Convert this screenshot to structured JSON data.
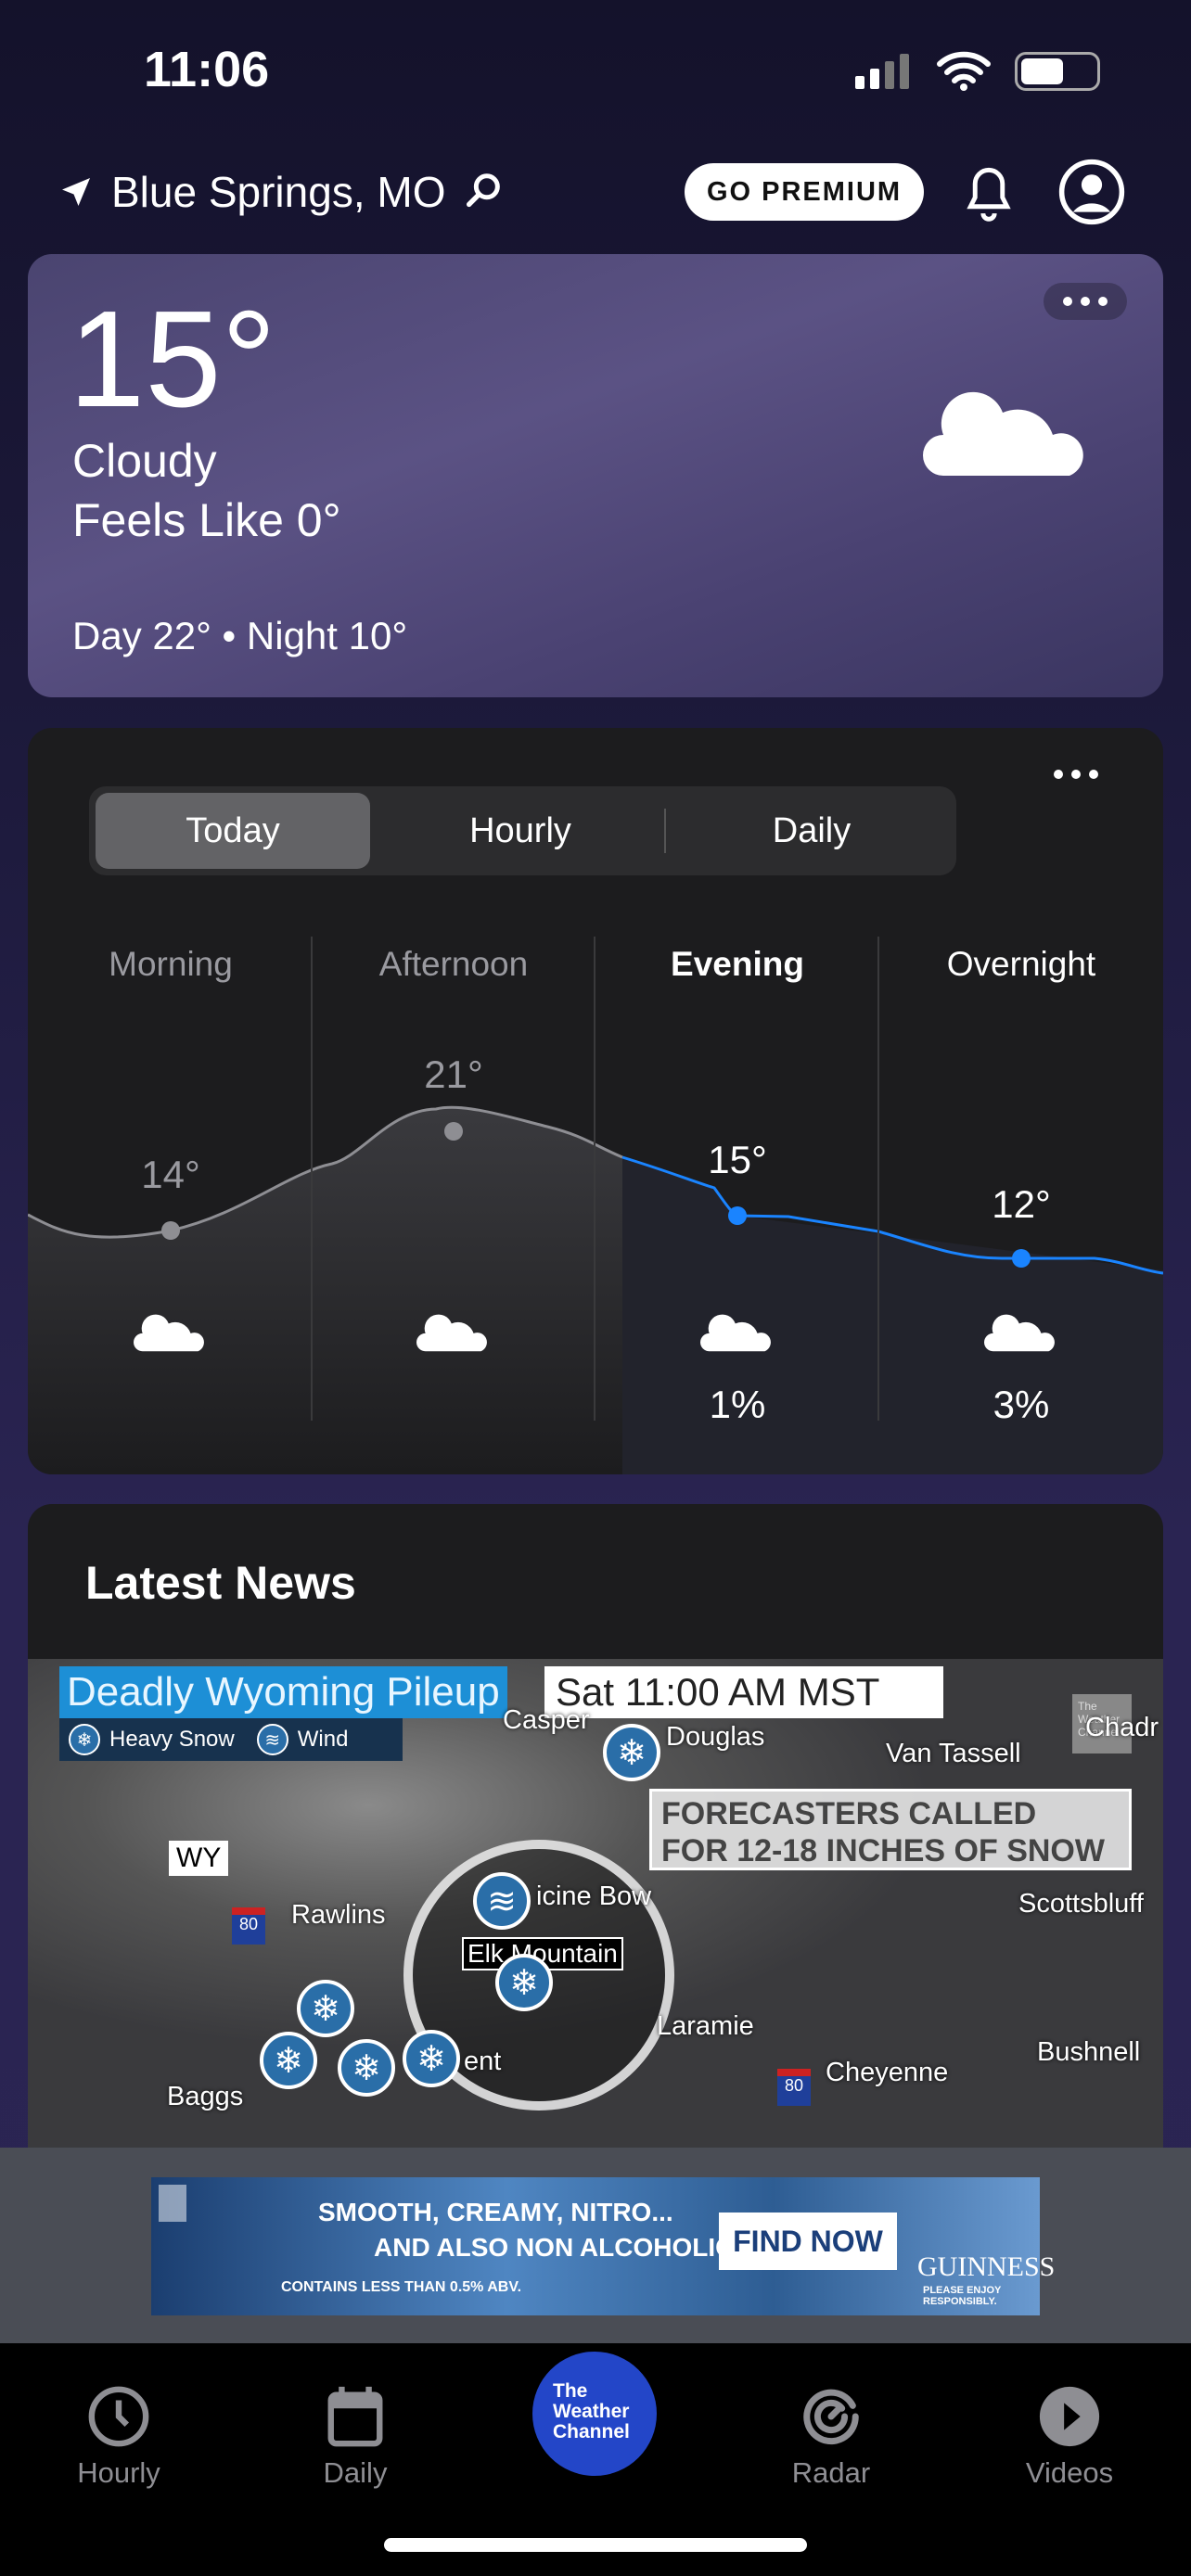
{
  "status": {
    "time": "11:06"
  },
  "header": {
    "location": "Blue Springs, MO",
    "premium_label": "GO PREMIUM"
  },
  "current": {
    "temp": "15°",
    "condition": "Cloudy",
    "feels_like": "Feels Like 0°",
    "day_night": "Day 22° • Night 10°",
    "icon": "cloud-icon"
  },
  "forecast": {
    "tabs": [
      {
        "label": "Today",
        "selected": true
      },
      {
        "label": "Hourly"
      },
      {
        "label": "Daily"
      }
    ],
    "periods": [
      {
        "label": "Morning",
        "temp": "14°",
        "precip": ""
      },
      {
        "label": "Afternoon",
        "temp": "21°",
        "precip": ""
      },
      {
        "label": "Evening",
        "temp": "15°",
        "precip": "1%",
        "current": true
      },
      {
        "label": "Overnight",
        "temp": "12°",
        "precip": "3%"
      }
    ],
    "colors": {
      "past": "#8e8e93",
      "future": "#1a84ff"
    }
  },
  "news": {
    "title": "Latest News",
    "image": {
      "headline": "Deadly Wyoming Pileup",
      "time": "Sat  11:00 AM MST",
      "legend": [
        "Heavy Snow",
        "Wind"
      ],
      "callout_1": "FORECASTERS CALLED",
      "callout_2": "FOR 12-18 INCHES OF SNOW",
      "places": {
        "casper": "Casper",
        "douglas": "Douglas",
        "van_tassell": "Van Tassell",
        "chadron": "Chadr",
        "wy": "WY",
        "rawlins": "Rawlins",
        "medicine_bow": "icine Bow",
        "elk": "Elk Mountain",
        "laramie": "Laramie",
        "scottsbluff": "Scottsbluff",
        "bushnell": "Bushnell",
        "cheyenne": "Cheyenne",
        "baggs": "Baggs",
        "ent": "ent",
        "i80": "80",
        "i80b": "80"
      },
      "watermark": "The Weather Channel"
    }
  },
  "ad": {
    "line1": "SMOOTH, CREAMY, NITRO...",
    "line2": "AND ALSO NON ALCOHOLIC",
    "line3": "CONTAINS LESS THAN 0.5% ABV.",
    "cta": "FIND NOW",
    "brand": "GUINNESS",
    "tagline": "PLEASE ENJOY RESPONSIBLY."
  },
  "tabbar": {
    "items": [
      {
        "label": "Hourly"
      },
      {
        "label": "Daily"
      },
      {
        "label": "The Weather Channel"
      },
      {
        "label": "Radar"
      },
      {
        "label": "Videos"
      }
    ],
    "logo_lines": [
      "The",
      "Weather",
      "Channel"
    ],
    "logo_color": "#2346c8"
  }
}
